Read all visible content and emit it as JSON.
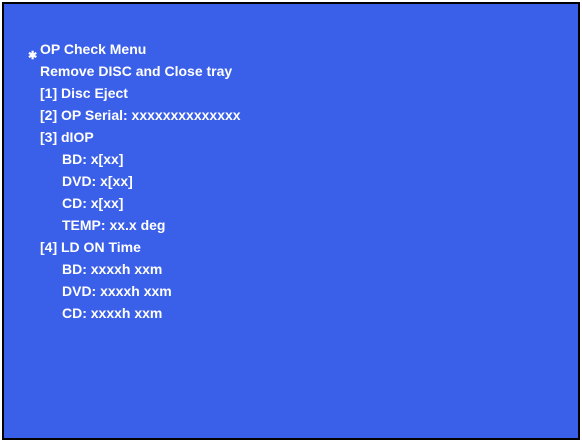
{
  "menu": {
    "bullet_icon": "asterisk-icon",
    "title": "OP Check Menu",
    "instruction": "Remove DISC and Close tray",
    "items": {
      "disc_eject": "[1] Disc Eject",
      "op_serial": "[2] OP Serial: xxxxxxxxxxxxxx",
      "diop": {
        "label": "[3] dIOP",
        "bd": "BD: x[xx]",
        "dvd": "DVD: x[xx]",
        "cd": "CD: x[xx]",
        "temp": "TEMP: xx.x deg"
      },
      "ld_on_time": {
        "label": "[4] LD ON Time",
        "bd": "BD: xxxxh xxm",
        "dvd": "DVD: xxxxh xxm",
        "cd": "CD: xxxxh xxm"
      }
    }
  },
  "colors": {
    "background": "#3a5fe8",
    "text": "#ffffff",
    "border": "#000000"
  }
}
